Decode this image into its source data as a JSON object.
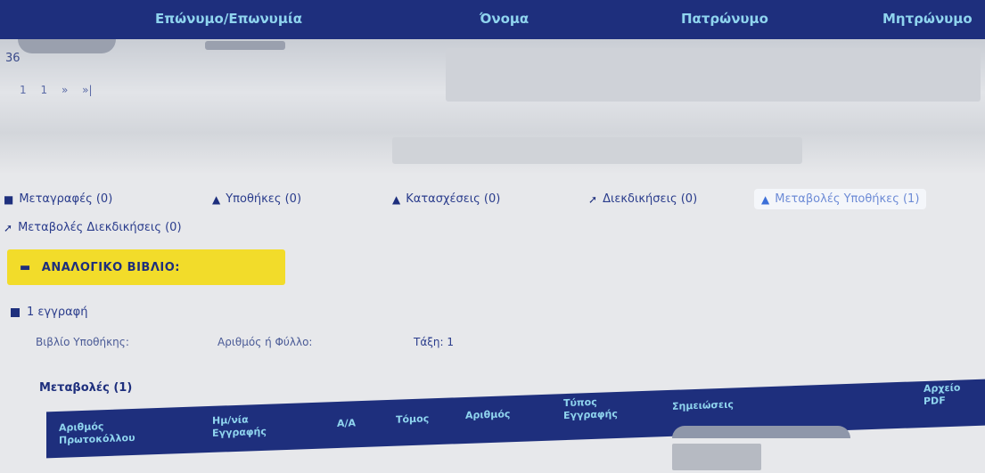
{
  "header": {
    "col1": "Επώνυμο/Επωνυμία",
    "col2": "Όνομα",
    "col3": "Πατρώνυμο",
    "col4": "Μητρώνυμο"
  },
  "record": {
    "id_prefix": "36"
  },
  "pager": [
    "1",
    "1",
    "»",
    "»|"
  ],
  "tabs": [
    {
      "label": "Μεταγραφές (0)",
      "icon": "house-icon"
    },
    {
      "label": "Υποθήκες (0)",
      "icon": "house-icon"
    },
    {
      "label": "Κατασχέσεις (0)",
      "icon": "house-icon"
    },
    {
      "label": "Διεκδικήσεις (0)",
      "icon": "gavel-icon"
    },
    {
      "label": "Μεταβολές Υποθήκες (1)",
      "icon": "house-icon",
      "active": true
    },
    {
      "label": "Μεταβολές Διεκδικήσεις (0)",
      "icon": "gavel-icon"
    }
  ],
  "analog_book": {
    "label": "ΑΝΑΛΟΓΙΚΟ ΒΙΒΛΙΟ:"
  },
  "entry": {
    "title": "1 εγγραφή",
    "book": "Βιβλίο Υποθήκης:",
    "number": "Αριθμός ή Φύλλο:",
    "page": "Τάξη: 1"
  },
  "changes": {
    "title": "Μεταβολές (1)",
    "columns": [
      "Αριθμός\nΠρωτοκόλλου",
      "Ημ/νία\nΕγγραφής",
      "Α/Α",
      "Τόμος",
      "Αριθμός",
      "Τύπος\nΕγγραφής",
      "Σημειώσεις",
      "Αρχείο\nPDF"
    ]
  },
  "colors": {
    "navy": "#1e2f7d",
    "accent_cyan": "#8fd4ee",
    "yellow": "#f2dc2a"
  }
}
